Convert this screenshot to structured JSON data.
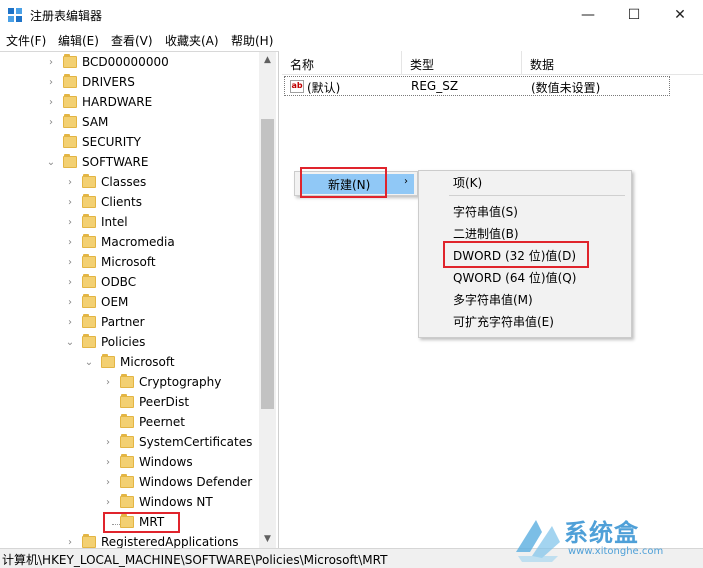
{
  "window": {
    "title": "注册表编辑器",
    "minimize_glyph": "—",
    "maximize_glyph": "☐",
    "close_glyph": "✕"
  },
  "menu": [
    "文件(F)",
    "编辑(E)",
    "查看(V)",
    "收藏夹(A)",
    "帮助(H)"
  ],
  "tree": {
    "items": [
      {
        "label": "BCD00000000",
        "chevron": "›"
      },
      {
        "label": "DRIVERS",
        "chevron": "›"
      },
      {
        "label": "HARDWARE",
        "chevron": "›"
      },
      {
        "label": "SAM",
        "chevron": "›"
      },
      {
        "label": "SECURITY",
        "chevron": ""
      },
      {
        "label": "SOFTWARE",
        "chevron": "⌄"
      },
      {
        "label": "Classes",
        "chevron": "›"
      },
      {
        "label": "Clients",
        "chevron": "›"
      },
      {
        "label": "Intel",
        "chevron": "›"
      },
      {
        "label": "Macromedia",
        "chevron": "›"
      },
      {
        "label": "Microsoft",
        "chevron": "›"
      },
      {
        "label": "ODBC",
        "chevron": "›"
      },
      {
        "label": "OEM",
        "chevron": "›"
      },
      {
        "label": "Partner",
        "chevron": "›"
      },
      {
        "label": "Policies",
        "chevron": "⌄"
      },
      {
        "label": "Microsoft",
        "chevron": "⌄"
      },
      {
        "label": "Cryptography",
        "chevron": "›"
      },
      {
        "label": "PeerDist",
        "chevron": ""
      },
      {
        "label": "Peernet",
        "chevron": ""
      },
      {
        "label": "SystemCertificates",
        "chevron": "›"
      },
      {
        "label": "Windows",
        "chevron": "›"
      },
      {
        "label": "Windows Defender",
        "chevron": "›"
      },
      {
        "label": "Windows NT",
        "chevron": "›"
      },
      {
        "label": "MRT",
        "chevron": ""
      },
      {
        "label": "RegisteredApplications",
        "chevron": "›"
      }
    ],
    "scroll_up_glyph": "▲",
    "scroll_down_glyph": "▼"
  },
  "list": {
    "columns": [
      "名称",
      "类型",
      "数据"
    ],
    "rows": [
      {
        "icon_text": "ab",
        "name": "(默认)",
        "type": "REG_SZ",
        "data": "(数值未设置)"
      }
    ]
  },
  "context_menu": {
    "new_label": "新建(N)",
    "new_arrow": "›",
    "submenu": [
      "项(K)",
      "字符串值(S)",
      "二进制值(B)",
      "DWORD (32 位)值(D)",
      "QWORD (64 位)值(Q)",
      "多字符串值(M)",
      "可扩充字符串值(E)"
    ]
  },
  "status": {
    "path": "计算机\\HKEY_LOCAL_MACHINE\\SOFTWARE\\Policies\\Microsoft\\MRT"
  },
  "watermark": {
    "brand": "系统盒",
    "url": "www.xitonghe.com"
  },
  "colors": {
    "highlight_box": "#e0242c",
    "menu_hover": "#90c8f6",
    "folder": "#f3d072",
    "watermark": "#4fa0d8"
  }
}
